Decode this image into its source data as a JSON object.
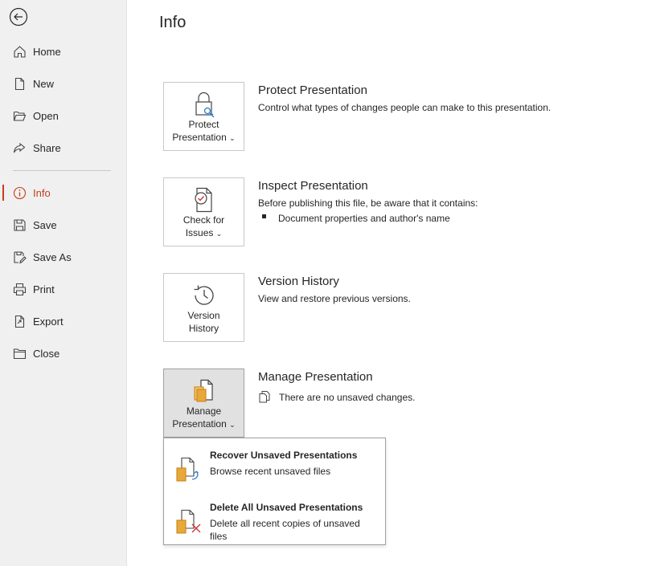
{
  "page": {
    "title": "Info"
  },
  "sidebar": {
    "items": [
      {
        "label": "Home",
        "icon": "home-icon"
      },
      {
        "label": "New",
        "icon": "new-doc-icon"
      },
      {
        "label": "Open",
        "icon": "open-folder-icon"
      },
      {
        "label": "Share",
        "icon": "share-icon"
      },
      {
        "label": "Info",
        "icon": "info-icon",
        "active": true
      },
      {
        "label": "Save",
        "icon": "save-icon"
      },
      {
        "label": "Save As",
        "icon": "save-as-icon"
      },
      {
        "label": "Print",
        "icon": "print-icon"
      },
      {
        "label": "Export",
        "icon": "export-icon"
      },
      {
        "label": "Close",
        "icon": "close-folder-icon"
      }
    ]
  },
  "sections": {
    "protect": {
      "button_line1": "Protect",
      "button_line2": "Presentation",
      "title": "Protect Presentation",
      "desc": "Control what types of changes people can make to this presentation."
    },
    "inspect": {
      "button_line1": "Check for",
      "button_line2": "Issues",
      "title": "Inspect Presentation",
      "desc": "Before publishing this file, be aware that it contains:",
      "bullet": "Document properties and author's name"
    },
    "version": {
      "button_line1": "Version",
      "button_line2": "History",
      "title": "Version History",
      "desc": "View and restore previous versions."
    },
    "manage": {
      "button_line1": "Manage",
      "button_line2": "Presentation",
      "title": "Manage Presentation",
      "desc": "There are no unsaved changes."
    }
  },
  "dropdown": {
    "items": [
      {
        "title": "Recover Unsaved Presentations",
        "desc": "Browse recent unsaved files"
      },
      {
        "title": "Delete All Unsaved Presentations",
        "desc": "Delete all recent copies of unsaved files"
      }
    ]
  },
  "colors": {
    "accent": "#c43e1c",
    "sidebar_bg": "#f0f0f0",
    "icon_gold": "#e8a83a",
    "delete_red": "#d13438"
  }
}
